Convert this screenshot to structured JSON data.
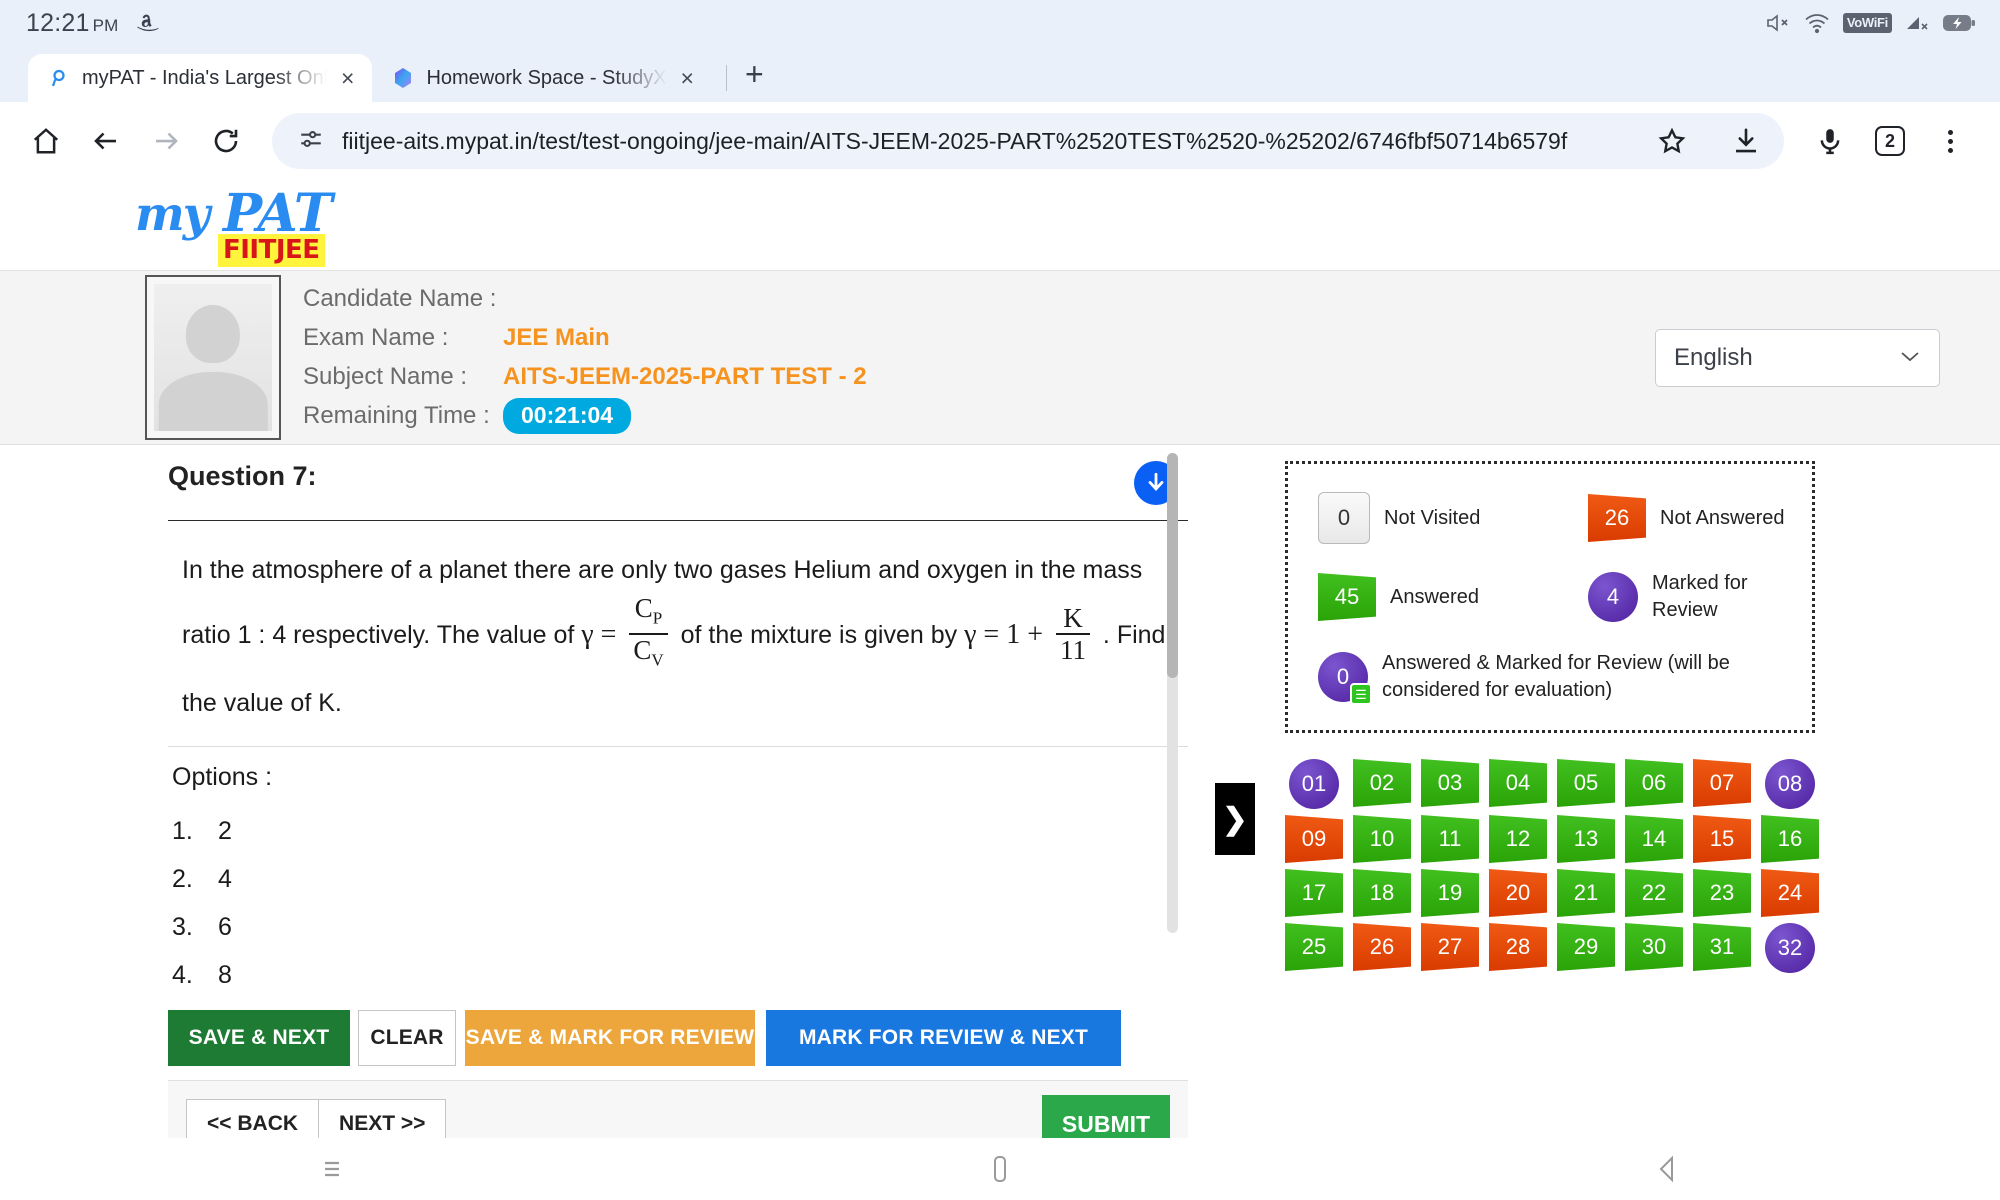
{
  "status_bar": {
    "time": "12:21",
    "ampm": "PM",
    "notification_icon": "amazon-icon",
    "icons": [
      "volume-mute-icon",
      "wifi-icon",
      "vowifi-badge",
      "signal-none-icon",
      "battery-charging-icon"
    ],
    "vowifi_label": "VoWiFi"
  },
  "browser": {
    "tabs": [
      {
        "title": "myPAT - India's Largest Onli",
        "favicon": "mypat-favicon",
        "active": true,
        "close_label": "×"
      },
      {
        "title": "Homework Space - StudyX",
        "favicon": "studyx-favicon",
        "active": false,
        "close_label": "×"
      }
    ],
    "new_tab_label": "+",
    "toolbar": {
      "home_icon": "home-icon",
      "back_icon": "back-arrow-icon",
      "forward_icon": "forward-arrow-icon",
      "reload_icon": "reload-icon",
      "site_info_icon": "permissions-icon",
      "url": "fiitjee-aits.mypat.in/test/test-ongoing/jee-main/AITS-JEEM-2025-PART%2520TEST%2520-%25202/6746fbf50714b6579f",
      "bookmark_icon": "star-icon",
      "download_icon": "download-icon",
      "mic_icon": "microphone-icon",
      "tab_count": "2",
      "menu_icon": "kebab-menu-icon"
    }
  },
  "app": {
    "logo": {
      "my": "my",
      "pat": "PAT",
      "sub": "FIITJEE"
    },
    "candidate": {
      "rows": [
        {
          "label": "Candidate Name :",
          "value": ""
        },
        {
          "label": "Exam Name :",
          "value": "JEE Main"
        },
        {
          "label": "Subject Name :",
          "value": "AITS-JEEM-2025-PART TEST - 2"
        },
        {
          "label": "Remaining Time :",
          "value": "00:21:04"
        }
      ]
    },
    "language": {
      "selected": "English",
      "chevron": "⌄"
    }
  },
  "question": {
    "title": "Question 7:",
    "download_icon": "download-circle-icon",
    "text_part1": "In the atmosphere of a planet there are only two gases Helium and oxygen in the mass ratio 1 : 4 respectively. The value of",
    "gamma": "γ",
    "equals": "=",
    "frac1_num": "C",
    "frac1_num_sub": "P",
    "frac1_den": "C",
    "frac1_den_sub": "V",
    "text_part2": "of the mixture is given by",
    "expr2_lead": "= 1 +",
    "frac2_num": "K",
    "frac2_den": "11",
    "text_part3": ". Find the value of K.",
    "options_label": "Options :",
    "options": [
      {
        "num": "1.",
        "text": "2"
      },
      {
        "num": "2.",
        "text": "4"
      },
      {
        "num": "3.",
        "text": "6"
      },
      {
        "num": "4.",
        "text": "8"
      }
    ]
  },
  "actions": {
    "save_next": "SAVE & NEXT",
    "clear": "CLEAR",
    "save_mark_review": "SAVE & MARK FOR REVIEW",
    "mark_review_next": "MARK FOR REVIEW & NEXT",
    "back": "<< BACK",
    "next": "NEXT >>",
    "submit": "SUBMIT"
  },
  "panel_toggle": {
    "icon": "chevron-right-icon",
    "label": "❯"
  },
  "legend": {
    "items": [
      {
        "count": "0",
        "label": "Not Visited",
        "shape": "square"
      },
      {
        "count": "26",
        "label": "Not Answered",
        "shape": "flag-orange"
      },
      {
        "count": "45",
        "label": "Answered",
        "shape": "flag-green"
      },
      {
        "count": "4",
        "label": "Marked for Review",
        "shape": "circle-purple"
      }
    ],
    "wide_item": {
      "count": "0",
      "label": "Answered & Marked for Review (will be considered for evaluation)",
      "shape": "circle-purple-doc"
    }
  },
  "palette": {
    "buttons": [
      {
        "n": "01",
        "state": "purple"
      },
      {
        "n": "02",
        "state": "green"
      },
      {
        "n": "03",
        "state": "green"
      },
      {
        "n": "04",
        "state": "green"
      },
      {
        "n": "05",
        "state": "green"
      },
      {
        "n": "06",
        "state": "green"
      },
      {
        "n": "07",
        "state": "orange"
      },
      {
        "n": "08",
        "state": "purple"
      },
      {
        "n": "09",
        "state": "orange"
      },
      {
        "n": "10",
        "state": "green"
      },
      {
        "n": "11",
        "state": "green"
      },
      {
        "n": "12",
        "state": "green"
      },
      {
        "n": "13",
        "state": "green"
      },
      {
        "n": "14",
        "state": "green"
      },
      {
        "n": "15",
        "state": "orange"
      },
      {
        "n": "16",
        "state": "green"
      },
      {
        "n": "17",
        "state": "green"
      },
      {
        "n": "18",
        "state": "green"
      },
      {
        "n": "19",
        "state": "green"
      },
      {
        "n": "20",
        "state": "orange"
      },
      {
        "n": "21",
        "state": "green"
      },
      {
        "n": "22",
        "state": "green"
      },
      {
        "n": "23",
        "state": "green"
      },
      {
        "n": "24",
        "state": "orange"
      },
      {
        "n": "25",
        "state": "green"
      },
      {
        "n": "26",
        "state": "orange"
      },
      {
        "n": "27",
        "state": "orange"
      },
      {
        "n": "28",
        "state": "orange"
      },
      {
        "n": "29",
        "state": "green"
      },
      {
        "n": "30",
        "state": "green"
      },
      {
        "n": "31",
        "state": "green"
      },
      {
        "n": "32",
        "state": "purple"
      }
    ]
  },
  "android_nav": {
    "recents_icon": "recents-icon",
    "home_icon": "home-pill-icon",
    "back_icon": "back-triangle-icon"
  },
  "colors": {
    "orange_accent": "#f6921e",
    "timer_blue": "#00a9e0",
    "green": "#2aa307",
    "red_orange": "#d93b00",
    "purple": "#4e1f9e",
    "brand_blue": "#2a8cf0"
  }
}
